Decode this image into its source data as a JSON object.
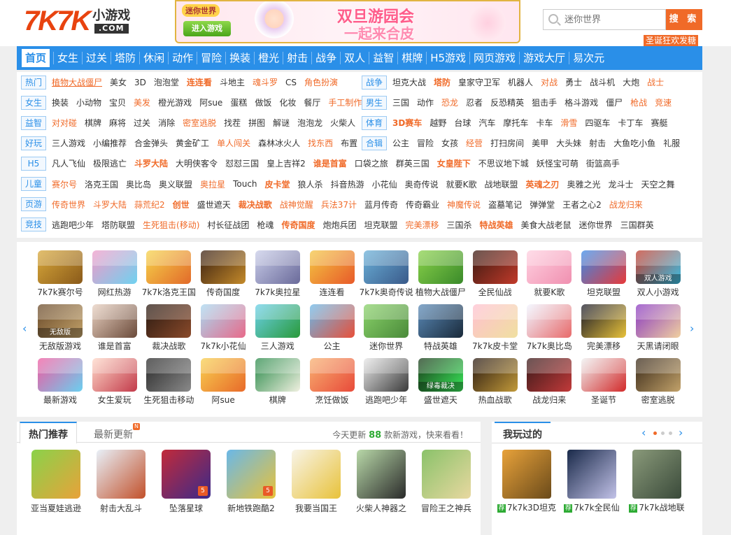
{
  "header": {
    "logo_main": "7K7K",
    "logo_cn": "小游戏",
    "logo_com": ".COM",
    "banner": {
      "tag": "迷你世界",
      "button": "进入游戏",
      "title1": "双旦游园会",
      "title2": "一起来合皮"
    },
    "search_placeholder": "迷你世界",
    "search_button": "搜 索",
    "promo": "圣诞狂欢发糖"
  },
  "nav": [
    "首页",
    "女生",
    "过关",
    "塔防",
    "休闲",
    "动作",
    "冒险",
    "换装",
    "橙光",
    "射击",
    "战争",
    "双人",
    "益智",
    "棋牌",
    "H5游戏",
    "网页游戏",
    "游戏大厅",
    "易次元"
  ],
  "category_rows": [
    {
      "tag": "热门",
      "items": [
        {
          "t": "植物大战僵尸",
          "c": "hot u"
        },
        {
          "t": "美女"
        },
        {
          "t": "3D"
        },
        {
          "t": "泡泡堂"
        },
        {
          "t": "连连看",
          "c": "hot b"
        },
        {
          "t": "斗地主"
        },
        {
          "t": "魂斗罗",
          "c": "hot"
        },
        {
          "t": "CS"
        },
        {
          "t": "角色扮演",
          "c": "hot"
        }
      ]
    },
    {
      "tag": "战争",
      "items": [
        {
          "t": "坦克大战"
        },
        {
          "t": "塔防",
          "c": "hot b"
        },
        {
          "t": "皇家守卫军"
        },
        {
          "t": "机器人"
        },
        {
          "t": "对战",
          "c": "hot"
        },
        {
          "t": "勇士"
        },
        {
          "t": "战斗机"
        },
        {
          "t": "大炮"
        },
        {
          "t": "战士",
          "c": "hot"
        }
      ]
    },
    {
      "tag": "女生",
      "items": [
        {
          "t": "换装"
        },
        {
          "t": "小动物"
        },
        {
          "t": "宝贝"
        },
        {
          "t": "美发",
          "c": "hot"
        },
        {
          "t": "橙光游戏"
        },
        {
          "t": "阿sue"
        },
        {
          "t": "蛋糕"
        },
        {
          "t": "做饭"
        },
        {
          "t": "化妆"
        },
        {
          "t": "餐厅"
        },
        {
          "t": "手工制作",
          "c": "hot"
        }
      ]
    },
    {
      "tag": "男生",
      "items": [
        {
          "t": "三国"
        },
        {
          "t": "动作"
        },
        {
          "t": "恐龙",
          "c": "hot"
        },
        {
          "t": "忍者"
        },
        {
          "t": "反恐精英"
        },
        {
          "t": "狙击手"
        },
        {
          "t": "格斗游戏"
        },
        {
          "t": "僵尸"
        },
        {
          "t": "枪战",
          "c": "hot"
        },
        {
          "t": "竞速",
          "c": "hot"
        }
      ]
    },
    {
      "tag": "益智",
      "items": [
        {
          "t": "对对碰",
          "c": "hot"
        },
        {
          "t": "棋牌"
        },
        {
          "t": "麻将"
        },
        {
          "t": "过关"
        },
        {
          "t": "消除"
        },
        {
          "t": "密室逃脱",
          "c": "hot"
        },
        {
          "t": "找茬"
        },
        {
          "t": "拼图"
        },
        {
          "t": "解谜"
        },
        {
          "t": "泡泡龙"
        },
        {
          "t": "火柴人"
        }
      ]
    },
    {
      "tag": "体育",
      "items": [
        {
          "t": "3D赛车",
          "c": "hot b"
        },
        {
          "t": "越野"
        },
        {
          "t": "台球"
        },
        {
          "t": "汽车"
        },
        {
          "t": "摩托车"
        },
        {
          "t": "卡车"
        },
        {
          "t": "滑雪",
          "c": "hot"
        },
        {
          "t": "四驱车"
        },
        {
          "t": "卡丁车"
        },
        {
          "t": "赛艇"
        }
      ]
    },
    {
      "tag": "好玩",
      "items": [
        {
          "t": "三人游戏"
        },
        {
          "t": "小编推荐"
        },
        {
          "t": "合金弹头"
        },
        {
          "t": "黄金矿工"
        },
        {
          "t": "单人闯关",
          "c": "hot"
        },
        {
          "t": "森林冰火人"
        },
        {
          "t": "找东西",
          "c": "hot"
        },
        {
          "t": "布置"
        }
      ]
    },
    {
      "tag": "合辑",
      "items": [
        {
          "t": "公主"
        },
        {
          "t": "冒险"
        },
        {
          "t": "女孩"
        },
        {
          "t": "经营",
          "c": "hot"
        },
        {
          "t": "打扫房间"
        },
        {
          "t": "美甲"
        },
        {
          "t": "大头妹"
        },
        {
          "t": "射击"
        },
        {
          "t": "大鱼吃小鱼"
        },
        {
          "t": "礼服"
        }
      ]
    },
    {
      "tag": "H5",
      "items": [
        {
          "t": "凡人飞仙"
        },
        {
          "t": "极限逃亡"
        },
        {
          "t": "斗罗大陆",
          "c": "hot b"
        },
        {
          "t": "大明侠客令"
        },
        {
          "t": "怼怼三国"
        },
        {
          "t": "皇上吉祥2"
        },
        {
          "t": "谁是首富",
          "c": "hot b"
        },
        {
          "t": "口袋之旅"
        },
        {
          "t": "群英三国"
        },
        {
          "t": "女皇陛下",
          "c": "hot b"
        },
        {
          "t": "不思议地下城"
        },
        {
          "t": "妖怪宝可萌"
        },
        {
          "t": "街篮高手"
        }
      ]
    },
    {
      "tag": "儿童",
      "items": [
        {
          "t": "赛尔号",
          "c": "hot"
        },
        {
          "t": "洛克王国"
        },
        {
          "t": "奥比岛"
        },
        {
          "t": "奥义联盟"
        },
        {
          "t": "奥拉星",
          "c": "hot"
        },
        {
          "t": "Touch"
        },
        {
          "t": "皮卡堂",
          "c": "hot b"
        },
        {
          "t": "狼人杀"
        },
        {
          "t": "抖音热游"
        },
        {
          "t": "小花仙"
        },
        {
          "t": "奥奇传说"
        },
        {
          "t": "就要K歌"
        },
        {
          "t": "战地联盟"
        },
        {
          "t": "英魂之刃",
          "c": "hot b"
        },
        {
          "t": "奥雅之光"
        },
        {
          "t": "龙斗士"
        },
        {
          "t": "天空之舞"
        }
      ]
    },
    {
      "tag": "页游",
      "items": [
        {
          "t": "传奇世界",
          "c": "hot"
        },
        {
          "t": "斗罗大陆",
          "c": "hot"
        },
        {
          "t": "蒜荒纪2",
          "c": "hot"
        },
        {
          "t": "创世",
          "c": "hot b"
        },
        {
          "t": "盛世遮天"
        },
        {
          "t": "裁决战歌",
          "c": "hot b"
        },
        {
          "t": "战神觉醒",
          "c": "hot"
        },
        {
          "t": "兵法37计",
          "c": "hot"
        },
        {
          "t": "蓝月传奇"
        },
        {
          "t": "传奇霸业"
        },
        {
          "t": "神魔传说",
          "c": "hot"
        },
        {
          "t": "盗墓笔记"
        },
        {
          "t": "弹弹堂"
        },
        {
          "t": "王者之心2"
        },
        {
          "t": "战龙归来",
          "c": "hot"
        }
      ]
    },
    {
      "tag": "竞技",
      "items": [
        {
          "t": "逃跑吧少年"
        },
        {
          "t": "塔防联盟"
        },
        {
          "t": "生死狙击(移动)",
          "c": "hot"
        },
        {
          "t": "村长征战团"
        },
        {
          "t": "枪魂"
        },
        {
          "t": "传奇国度",
          "c": "hot b"
        },
        {
          "t": "炮炮兵团"
        },
        {
          "t": "坦克联盟"
        },
        {
          "t": "完美漂移",
          "c": "hot"
        },
        {
          "t": "三国杀"
        },
        {
          "t": "特战英雄",
          "c": "hot b"
        },
        {
          "t": "美食大战老鼠"
        },
        {
          "t": "迷你世界"
        },
        {
          "t": "三国群英"
        }
      ]
    }
  ],
  "grid_games": [
    {
      "name": "7k7k赛尔号",
      "c1": "#d8a83a",
      "c2": "#8a5a1a",
      "icon": "robot-icon"
    },
    {
      "name": "网红热游",
      "c1": "#f09ac8",
      "c2": "#6fd2f0",
      "icon": "spiral-icon"
    },
    {
      "name": "7k7k洛克王国",
      "c1": "#f6d34a",
      "c2": "#e26a2a",
      "icon": "castle-icon"
    },
    {
      "name": "传奇国度",
      "c1": "#3a2012",
      "c2": "#c48a2a",
      "icon": "legend-icon"
    },
    {
      "name": "7k7k奥拉星",
      "c1": "#c8cce8",
      "c2": "#6a6a9a",
      "icon": "hero-icon"
    },
    {
      "name": "连连看",
      "c1": "#f4c642",
      "c2": "#e85a2a",
      "icon": "fruit-icon"
    },
    {
      "name": "7k7k奥奇传说",
      "c1": "#6ab0d8",
      "c2": "#3a5a8a",
      "icon": "girl-icon"
    },
    {
      "name": "植物大战僵尸",
      "c1": "#8ad24a",
      "c2": "#3a8a2a",
      "icon": "plant-icon"
    },
    {
      "name": "全民仙战",
      "c1": "#3a1a12",
      "c2": "#c23a2a",
      "icon": "warrior-icon"
    },
    {
      "name": "就要K歌",
      "c1": "#ffd0e0",
      "c2": "#f090b0",
      "icon": "singer-icon"
    },
    {
      "name": "坦克联盟",
      "c1": "#3a8ae8",
      "c2": "#e83a3a",
      "icon": "tank-icon"
    },
    {
      "name": "双人小游戏",
      "c1": "#c23a2a",
      "c2": "#3ac2e8",
      "icon": "fire-water-icon",
      "ov": "双人游戏"
    },
    {
      "name": "无敌版游戏",
      "c1": "#6a4a2a",
      "c2": "#c2a26a",
      "icon": "unlimited-icon",
      "ov": "无敌版"
    },
    {
      "name": "谁是首富",
      "c1": "#e8d0c0",
      "c2": "#6a4a3a",
      "icon": "woman-icon"
    },
    {
      "name": "裁决战歌",
      "c1": "#2a1a12",
      "c2": "#8a4a2a",
      "icon": "warrior-icon"
    },
    {
      "name": "7k7k小花仙",
      "c1": "#a8d8f0",
      "c2": "#e86a8a",
      "icon": "fairy-icon"
    },
    {
      "name": "三人游戏",
      "c1": "#6ad0e8",
      "c2": "#2a9a3a",
      "icon": "blocks-icon"
    },
    {
      "name": "公主",
      "c1": "#6ab8e8",
      "c2": "#e8503a",
      "icon": "princess-icon"
    },
    {
      "name": "迷你世界",
      "c1": "#8ad26a",
      "c2": "#4a8a3a",
      "icon": "cube-icon"
    },
    {
      "name": "特战英雄",
      "c1": "#5a8ab8",
      "c2": "#1a2a3a",
      "icon": "gun-icon"
    },
    {
      "name": "7k7k皮卡堂",
      "c1": "#ffc0d0",
      "c2": "#f0e0a0",
      "icon": "house-icon"
    },
    {
      "name": "7k7k奥比岛",
      "c1": "#f0f4ff",
      "c2": "#e86a6a",
      "icon": "mascot-icon"
    },
    {
      "name": "完美漂移",
      "c1": "#1a1a2a",
      "c2": "#e8c23a",
      "icon": "car-icon"
    },
    {
      "name": "天黑请闭眼",
      "c1": "#8a3ac2",
      "c2": "#f0d0a0",
      "icon": "mask-icon"
    },
    {
      "name": "最新游戏",
      "c1": "#f05aa0",
      "c2": "#6ad0f0",
      "icon": "new-icon"
    },
    {
      "name": "女生爱玩",
      "c1": "#ffd8c8",
      "c2": "#c23a4a",
      "icon": "girl-icon"
    },
    {
      "name": "生死狙击移动",
      "c1": "#2a2a2a",
      "c2": "#8a8a8a",
      "icon": "sniper-icon"
    },
    {
      "name": "阿sue",
      "c1": "#f8d050",
      "c2": "#e86a2a",
      "icon": "sue-icon"
    },
    {
      "name": "棋牌",
      "c1": "#2a8a4a",
      "c2": "#f0f0e0",
      "icon": "mahjong-icon"
    },
    {
      "name": "烹饪做饭",
      "c1": "#f8b070",
      "c2": "#e84a3a",
      "icon": "cooking-icon"
    },
    {
      "name": "逃跑吧少年",
      "c1": "#e8e8e8",
      "c2": "#3a3a3a",
      "icon": "escape-icon"
    },
    {
      "name": "盛世遮天",
      "c1": "#1a3a1a",
      "c2": "#3ae85a",
      "icon": "sword-icon",
      "ov": "绿毒裁决"
    },
    {
      "name": "热血战歌",
      "c1": "#2a1a12",
      "c2": "#c29a3a",
      "icon": "warrior-icon"
    },
    {
      "name": "战龙归来",
      "c1": "#3a1a1a",
      "c2": "#c23a3a",
      "icon": "dragon-icon"
    },
    {
      "name": "圣诞节",
      "c1": "#f0f0f0",
      "c2": "#d22a2a",
      "icon": "santa-icon"
    },
    {
      "name": "密室逃脱",
      "c1": "#3a2a1a",
      "c2": "#c2a26a",
      "icon": "door-icon"
    }
  ],
  "hot": {
    "tab1": "热门推荐",
    "tab2": "最新更新",
    "update_prefix": "今天更新",
    "update_count": "88",
    "update_suffix": "款新游戏，快来看看！",
    "games": [
      {
        "name": "亚当夏娃逃逊",
        "c1": "#8ad24a",
        "c2": "#e8a23a",
        "icon": "adam-icon"
      },
      {
        "name": "射击大乱斗",
        "c1": "#e8f0f8",
        "c2": "#c2502a",
        "icon": "shooter-icon"
      },
      {
        "name": "坠落星球",
        "c1": "#c22a3a",
        "c2": "#3a2a8a",
        "icon": "among-icon",
        "h5": true
      },
      {
        "name": "新地铁跑酷2",
        "c1": "#6ab8e8",
        "c2": "#e8c23a",
        "icon": "subway-icon",
        "h5": true
      },
      {
        "name": "我要当国王",
        "c1": "#f8f4e8",
        "c2": "#e8c23a",
        "icon": "king-icon"
      },
      {
        "name": "火柴人神器之",
        "c1": "#b8d8a8",
        "c2": "#2a2a2a",
        "icon": "stickman-icon"
      },
      {
        "name": "冒险王之神兵",
        "c1": "#8ac26a",
        "c2": "#e8d8a0",
        "icon": "adventure-icon"
      }
    ]
  },
  "played": {
    "title": "我玩过的",
    "games": [
      {
        "name": "7k7k3D坦克",
        "c1": "#e8a23a",
        "c2": "#6a4a1a",
        "icon": "tank-icon"
      },
      {
        "name": "7k7k全民仙",
        "c1": "#1a2a4a",
        "c2": "#c2c2e8",
        "icon": "warrior-icon"
      },
      {
        "name": "7k7k战地联",
        "c1": "#8a9a7a",
        "c2": "#3a4a3a",
        "icon": "soldier-icon"
      }
    ]
  }
}
